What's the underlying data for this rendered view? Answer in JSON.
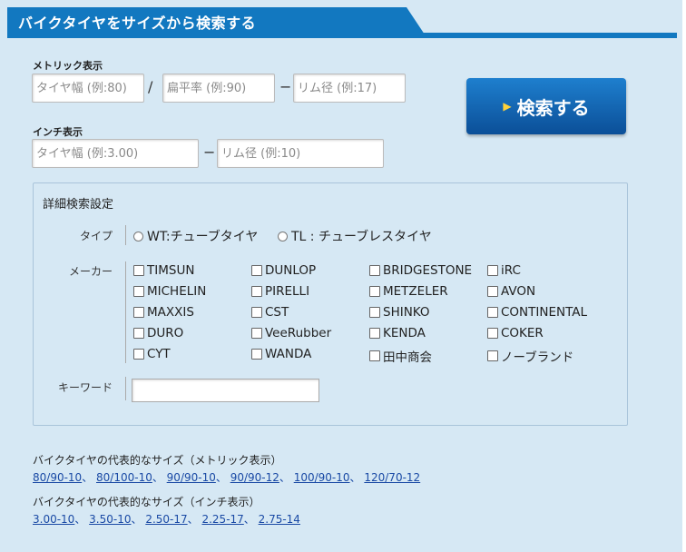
{
  "header": {
    "title": "バイクタイヤをサイズから検索する"
  },
  "metric": {
    "label": "メトリック表示",
    "width_placeholder": "タイヤ幅 (例:80)",
    "slash": "/",
    "aspect_placeholder": "扁平率 (例:90)",
    "dash": "−",
    "rim_placeholder": "リム径 (例:17)"
  },
  "inch": {
    "label": "インチ表示",
    "width_placeholder": "タイヤ幅 (例:3.00)",
    "dash": "−",
    "rim_placeholder": "リム径 (例:10)"
  },
  "search_button": {
    "arrow": "▶",
    "label": "検索する"
  },
  "detail": {
    "title": "詳細検索設定",
    "type_label": "タイプ",
    "types": [
      "WT:チューブタイヤ",
      "TL : チューブレスタイヤ"
    ],
    "maker_label": "メーカー",
    "makers": [
      [
        "TIMSUN",
        "DUNLOP",
        "BRIDGESTONE",
        "iRC"
      ],
      [
        "MICHELIN",
        "PIRELLI",
        "METZELER",
        "AVON"
      ],
      [
        "MAXXIS",
        "CST",
        "SHINKO",
        "CONTINENTAL"
      ],
      [
        "DURO",
        "VeeRubber",
        "KENDA",
        "COKER"
      ],
      [
        "CYT",
        "WANDA",
        "田中商会",
        "ノーブランド"
      ]
    ],
    "keyword_label": "キーワード",
    "keyword_value": ""
  },
  "popular_metric": {
    "title": "バイクタイヤの代表的なサイズ（メトリック表示）",
    "links": [
      "80/90-10",
      "80/100-10",
      "90/90-10",
      "90/90-12",
      "100/90-10",
      "120/70-12"
    ]
  },
  "popular_inch": {
    "title": "バイクタイヤの代表的なサイズ（インチ表示）",
    "links": [
      "3.00-10",
      "3.50-10",
      "2.50-17",
      "2.25-17",
      "2.75-14"
    ]
  },
  "colors": {
    "header_blue": "#1278c0",
    "panel_bg": "#d6e8f4",
    "link": "#1a4aa5",
    "button_arrow": "#ffd23a"
  }
}
